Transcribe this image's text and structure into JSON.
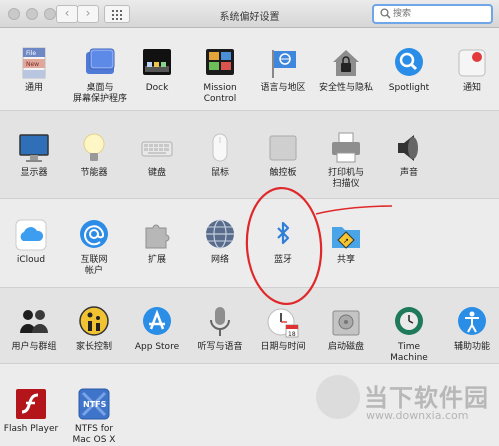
{
  "window": {
    "title": "系统偏好设置"
  },
  "search": {
    "placeholder": "搜索"
  },
  "toolbar": {
    "back_glyph": "‹",
    "forward_glyph": "›"
  },
  "rows": [
    {
      "items": [
        {
          "id": "general",
          "label": "通用",
          "icon": "general-icon"
        },
        {
          "id": "desktop",
          "label": "桌面与\n屏幕保护程序",
          "icon": "desktop-icon"
        },
        {
          "id": "dock",
          "label": "Dock",
          "icon": "dock-icon"
        },
        {
          "id": "mission",
          "label": "Mission\nControl",
          "icon": "mission-control-icon"
        },
        {
          "id": "language",
          "label": "语言与地区",
          "icon": "flag-icon"
        },
        {
          "id": "security",
          "label": "安全性与隐私",
          "icon": "house-lock-icon"
        },
        {
          "id": "spotlight",
          "label": "Spotlight",
          "icon": "spotlight-icon"
        },
        {
          "id": "notifications",
          "label": "通知",
          "icon": "notifications-icon"
        }
      ]
    },
    {
      "items": [
        {
          "id": "displays",
          "label": "显示器",
          "icon": "display-icon"
        },
        {
          "id": "energy",
          "label": "节能器",
          "icon": "bulb-icon"
        },
        {
          "id": "keyboard",
          "label": "键盘",
          "icon": "keyboard-icon"
        },
        {
          "id": "mouse",
          "label": "鼠标",
          "icon": "mouse-icon"
        },
        {
          "id": "trackpad",
          "label": "触控板",
          "icon": "trackpad-icon"
        },
        {
          "id": "printers",
          "label": "打印机与\n扫描仪",
          "icon": "printer-icon"
        },
        {
          "id": "sound",
          "label": "声音",
          "icon": "speaker-icon"
        }
      ]
    },
    {
      "items": [
        {
          "id": "icloud",
          "label": "iCloud",
          "icon": "icloud-icon"
        },
        {
          "id": "internet",
          "label": "互联网\n帐户",
          "icon": "at-icon"
        },
        {
          "id": "extensions",
          "label": "扩展",
          "icon": "puzzle-icon"
        },
        {
          "id": "network",
          "label": "网络",
          "icon": "globe-icon"
        },
        {
          "id": "bluetooth",
          "label": "蓝牙",
          "icon": "bluetooth-icon"
        },
        {
          "id": "sharing",
          "label": "共享",
          "icon": "sharing-icon"
        }
      ]
    },
    {
      "items": [
        {
          "id": "users",
          "label": "用户与群组",
          "icon": "users-icon"
        },
        {
          "id": "parental",
          "label": "家长控制",
          "icon": "parental-icon"
        },
        {
          "id": "appstore",
          "label": "App Store",
          "icon": "appstore-icon"
        },
        {
          "id": "dictation",
          "label": "听写与语音",
          "icon": "microphone-icon"
        },
        {
          "id": "datetime",
          "label": "日期与时间",
          "icon": "clock-icon"
        },
        {
          "id": "startup",
          "label": "启动磁盘",
          "icon": "disk-icon"
        },
        {
          "id": "timemachine",
          "label": "Time Machine",
          "icon": "timemachine-icon"
        },
        {
          "id": "accessibility",
          "label": "辅助功能",
          "icon": "accessibility-icon"
        }
      ]
    },
    {
      "items": [
        {
          "id": "flash",
          "label": "Flash Player",
          "icon": "flash-icon"
        },
        {
          "id": "ntfs",
          "label": "NTFS for\nMac OS X",
          "icon": "ntfs-icon"
        }
      ]
    }
  ],
  "icon_text": {
    "general_file": "File",
    "general_new": "New",
    "ntfs": "NTFS",
    "calendar_day": "18"
  },
  "watermark": {
    "title": "当下软件园",
    "url": "www.downxia.com"
  },
  "colors": {
    "annotation": "#e0282a",
    "search_focus": "#6ea6e8"
  }
}
